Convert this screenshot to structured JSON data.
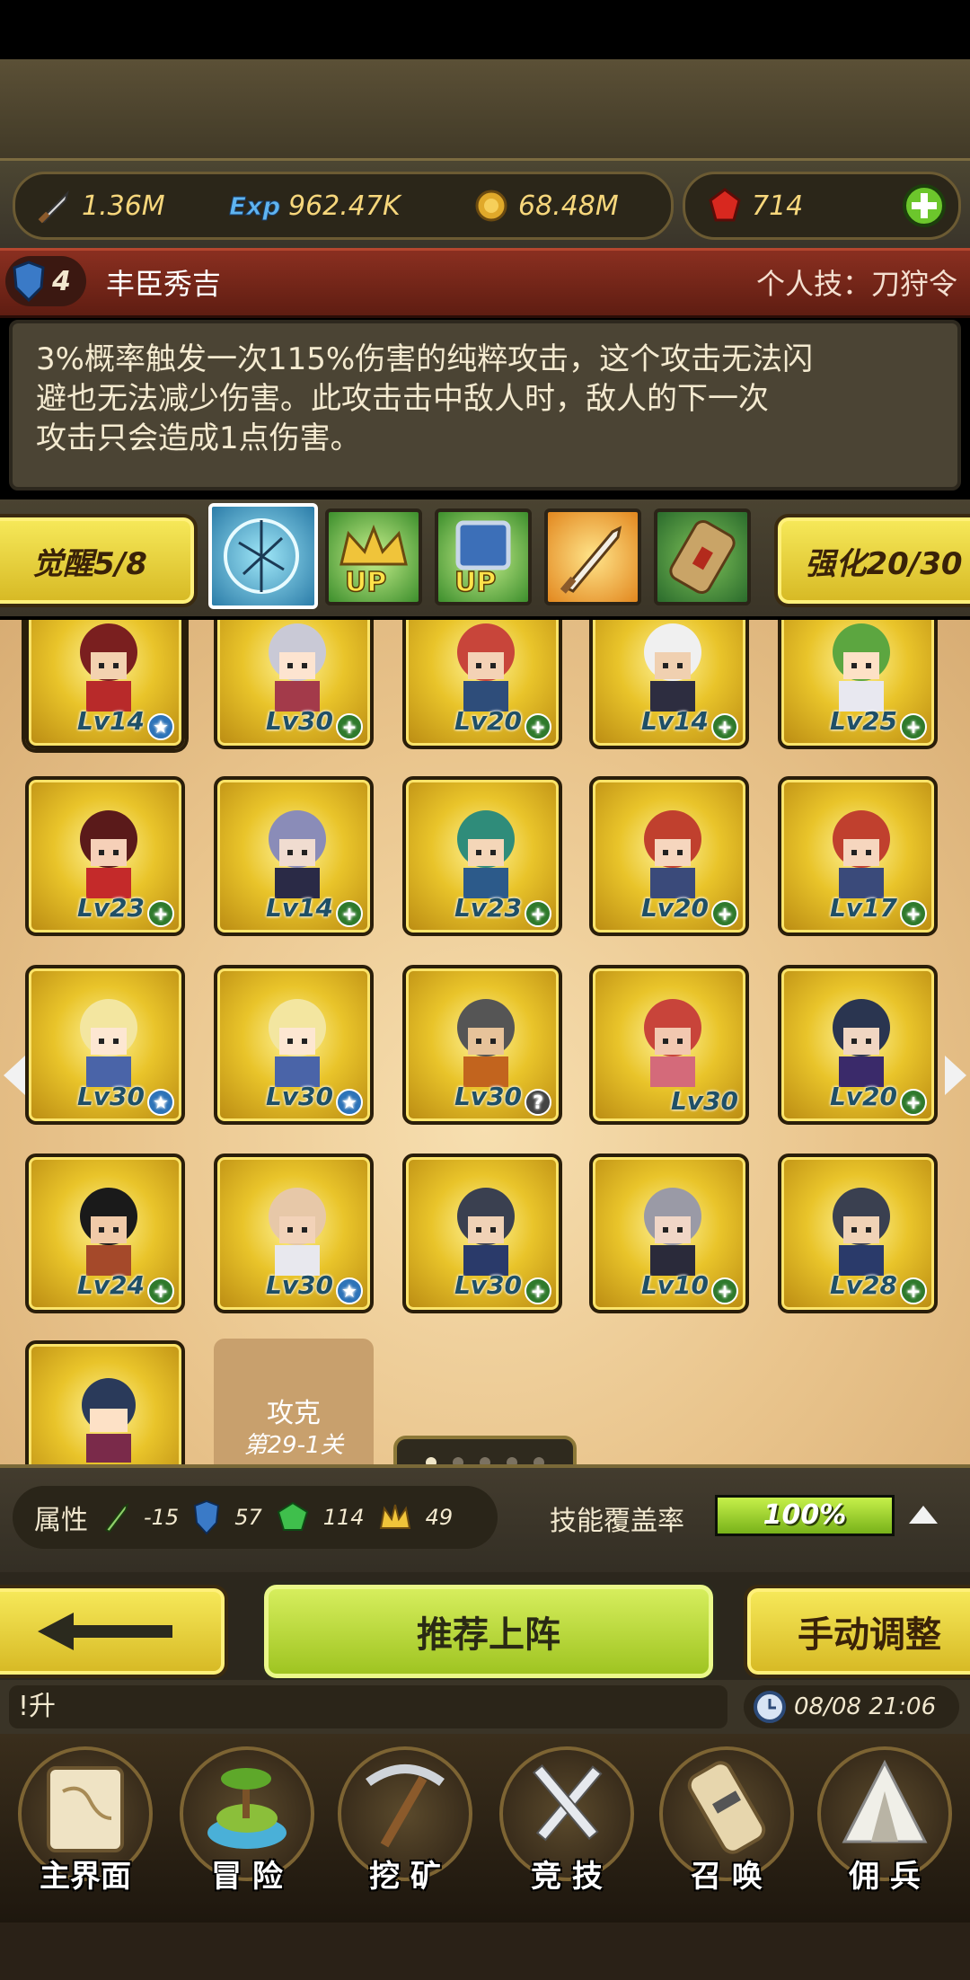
{
  "currency": {
    "attack": "1.36M",
    "exp": "962.47K",
    "gold": "68.48M",
    "gems": "714"
  },
  "hero": {
    "rank": "4",
    "name": "丰臣秀吉",
    "skill_label": "个人技：刀狩令",
    "description_line1": "3%概率触发一次115%伤害的纯粹攻击，这个攻击无法闪",
    "description_line2": "避也无法减少伤害。此攻击击中敌人时，敌人的下一次",
    "description_line3": "攻击只会造成1点伤害。"
  },
  "tabs": {
    "awaken": "觉醒5/8",
    "enhance": "强化20/30",
    "skill_icons": [
      "magic-circle-icon",
      "crown-up-icon",
      "shield-up-icon",
      "sword-icon",
      "scroll-icon"
    ],
    "up_label": "UP"
  },
  "heroes": [
    {
      "lv": "Lv14",
      "badge": "star"
    },
    {
      "lv": "Lv30",
      "badge": "plus"
    },
    {
      "lv": "Lv20",
      "badge": "plus"
    },
    {
      "lv": "Lv14",
      "badge": "plus"
    },
    {
      "lv": "Lv25",
      "badge": "plus"
    },
    {
      "lv": "Lv23",
      "badge": "plus"
    },
    {
      "lv": "Lv14",
      "badge": "plus"
    },
    {
      "lv": "Lv23",
      "badge": "plus"
    },
    {
      "lv": "Lv20",
      "badge": "plus"
    },
    {
      "lv": "Lv17",
      "badge": "plus"
    },
    {
      "lv": "Lv30",
      "badge": "star"
    },
    {
      "lv": "Lv30",
      "badge": "star"
    },
    {
      "lv": "Lv30",
      "badge": "q"
    },
    {
      "lv": "Lv30",
      "badge": "none"
    },
    {
      "lv": "Lv20",
      "badge": "plus"
    },
    {
      "lv": "Lv24",
      "badge": "plus"
    },
    {
      "lv": "Lv30",
      "badge": "star"
    },
    {
      "lv": "Lv30",
      "badge": "plus"
    },
    {
      "lv": "Lv10",
      "badge": "plus"
    },
    {
      "lv": "Lv28",
      "badge": "plus"
    }
  ],
  "locked": {
    "line1": "攻克",
    "line2": "第29-1关"
  },
  "attributes": {
    "label": "属性",
    "values": [
      "-15",
      "57",
      "114",
      "49"
    ],
    "coverage_label": "技能覆盖率",
    "coverage_value": "100%",
    "coverage_fraction": 1.0
  },
  "actions": {
    "recommend": "推荐上阵",
    "manual": "手动调整"
  },
  "chat": {
    "text": "!升",
    "time": "08/08 21:06"
  },
  "nav": [
    "主界面",
    "冒 险",
    "挖 矿",
    "竞 技",
    "召 唤",
    "佣 兵"
  ],
  "colors": {
    "gold": "#f7d77c",
    "card_yellow": "#e9c42a",
    "green_button": "#c6e03a",
    "red_bar": "#8a2f20"
  }
}
